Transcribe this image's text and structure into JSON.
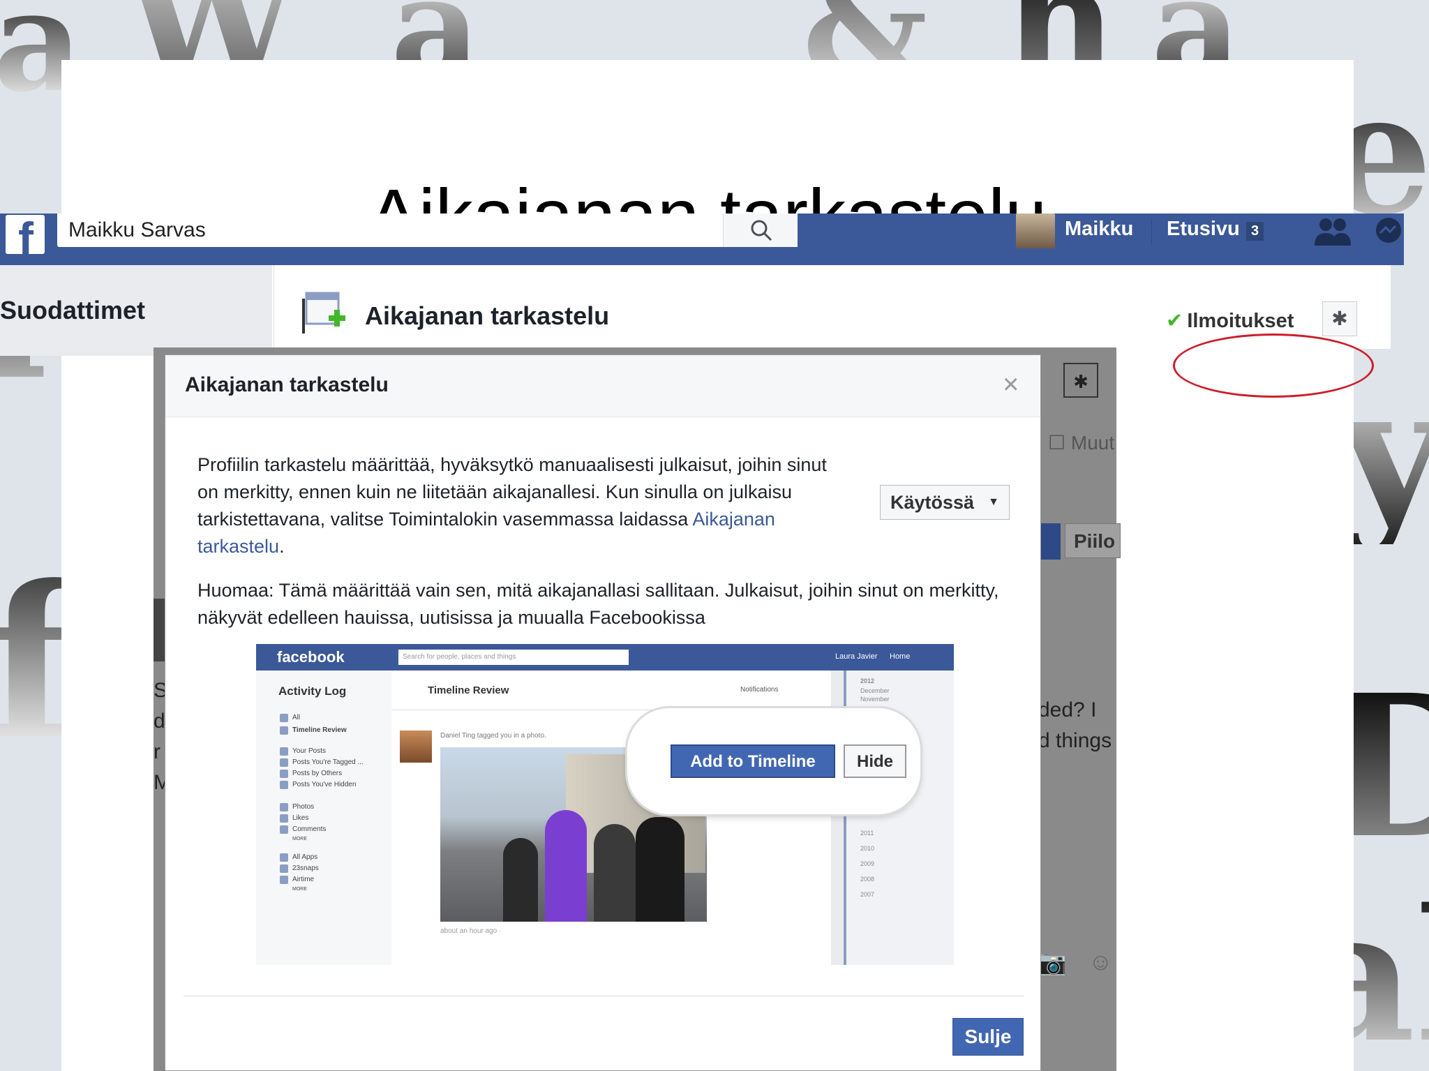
{
  "slide": {
    "title": "Aikajanan tarkastelu"
  },
  "fb": {
    "search_value": "Maikku Sarvas",
    "user_name": "Maikku",
    "home_label": "Etusivu",
    "home_count": "3",
    "sidebar_label": "Suodattimet",
    "page_title": "Aikajanan tarkastelu",
    "notifications_label": "Ilmoitukset",
    "bg_checkbox_label": "Muut",
    "bg_hide_label": "Piilo",
    "bg_right_text": "ded? I\nd things",
    "bg_left_text": "S\nd\nr\nM"
  },
  "modal": {
    "title": "Aikajanan tarkastelu",
    "close_glyph": "×",
    "para_text": "Profiilin tarkastelu määrittää, hyväksytkö manuaalisesti julkaisut, joihin sinut on merkitty, ennen kuin ne liitetään aikajanallesi. Kun sinulla on julkaisu tarkistettavana, valitse Toimintalokin vasemmassa laidassa ",
    "para_link": "Aikajanan tarkastelu",
    "para_end": ".",
    "note": "Huomaa: Tämä määrittää vain sen, mitä aikajanallasi sallitaan. Julkaisut, joihin sinut on merkitty, näkyvät edelleen hauissa, uutisissa ja muualla Facebookissa",
    "status_label": "Käytössä",
    "close_button": "Sulje"
  },
  "illustration": {
    "logo": "facebook",
    "search_placeholder": "Search for people, places and things",
    "user": "Laura Javier",
    "home": "Home",
    "sidebar_title": "Activity Log",
    "sidebar_items": [
      "All",
      "Timeline Review",
      "Your Posts",
      "Posts You're Tagged ...",
      "Posts by Others",
      "Posts You've Hidden",
      "Photos",
      "Likes",
      "Comments",
      "MORE",
      "All Apps",
      "23snaps",
      "Airtime",
      "MORE"
    ],
    "title": "Timeline Review",
    "notifications": "Notifications",
    "post_text": "Daniel Ting tagged you in a photo.",
    "post_time": "about an hour ago ·",
    "add_button": "Add to Timeline",
    "hide_button": "Hide",
    "years": [
      "2012",
      "December",
      "November",
      "2011",
      "2010",
      "2009",
      "2008",
      "2007"
    ]
  },
  "colors": {
    "fb_blue": "#3b5998",
    "button_blue": "#4267b2",
    "annotation_red": "#cc1e2a"
  },
  "icons": [
    "facebook-logo-icon",
    "search-icon",
    "friends-icon",
    "messages-icon",
    "timeline-review-icon",
    "checkmark-icon",
    "gear-icon",
    "close-icon",
    "caret-down-icon",
    "camera-icon",
    "smiley-icon"
  ]
}
